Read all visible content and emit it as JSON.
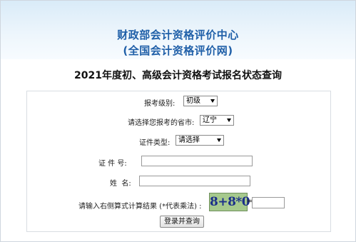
{
  "header": {
    "org_name": "财政部会计资格评价中心",
    "org_site": "(全国会计资格评价网)"
  },
  "page_title": "2021年度初、高级会计资格考试报名状态查询",
  "form": {
    "level_label": "报考级别:",
    "level_value": "初级",
    "province_label": "请选择您报考的省市:",
    "province_value": "辽宁",
    "id_type_label": "证件类型:",
    "id_type_value": "请选择",
    "id_number_label": "证 件 号:",
    "name_label": "姓  名:",
    "captcha_label": "请输入右侧算式计算结果 (*代表乘法) :",
    "captcha_text": "8+8*0",
    "equals": "=",
    "submit_label": "登录并查询"
  }
}
